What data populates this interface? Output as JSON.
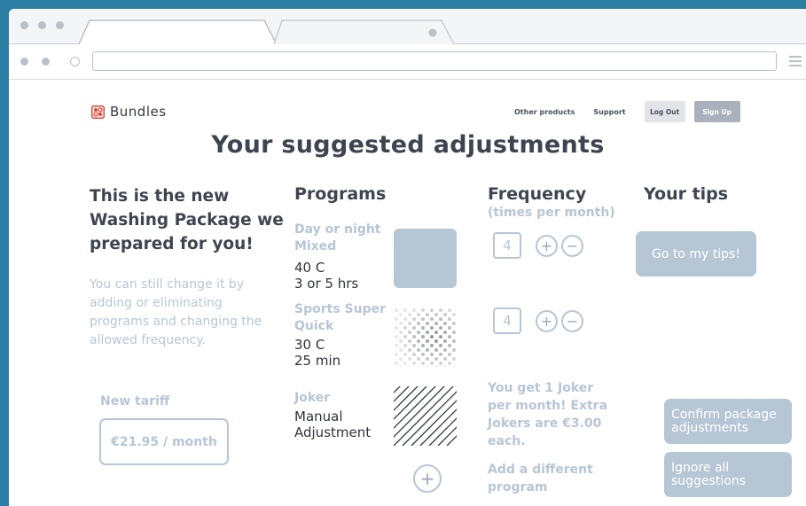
{
  "browser": {
    "address_value": "",
    "icons": [
      "window-dot-icon",
      "tab-icon",
      "reload-icon",
      "menu-icon"
    ]
  },
  "brand": {
    "name": "Bundles",
    "accent": "#e8412e"
  },
  "nav": {
    "other_products": "Other products",
    "support": "Support",
    "log_out": "Log Out",
    "sign_up": "Sign Up"
  },
  "main_title": "Your suggested adjustments",
  "intro": {
    "heading": "This is the new Washing Package we prepared for you!",
    "text": "You can still change it by adding or eliminating programs and changing the allowed frequency."
  },
  "tariff": {
    "label": "New tariff",
    "value": "€21.95 / month"
  },
  "programs": {
    "title": "Programs",
    "items": [
      {
        "name": "Day or night Mixed",
        "detail_line1": "40 C",
        "detail_line2": "3 or 5 hrs",
        "image": "solid"
      },
      {
        "name": "Sports Super Quick",
        "detail_line1": "30 C",
        "detail_line2": "25 min",
        "image": "dots"
      },
      {
        "name": "Joker",
        "detail_line1": "Manual",
        "detail_line2": "Adjustment",
        "image": "stripes"
      }
    ]
  },
  "frequency": {
    "title": "Frequency",
    "subtitle": "(times per month)",
    "values": [
      "4",
      "4"
    ],
    "joker_note": "You get 1 Joker per month! Extra Jokers are €3.00 each.",
    "add_program": "Add a different program"
  },
  "tips": {
    "title": "Your tips",
    "go_button": "Go to my tips!",
    "confirm_button": "Confirm package adjustments",
    "ignore_button": "Ignore all suggestions"
  },
  "colors": {
    "background": "#2b7ea3",
    "muted": "#b7c6d5",
    "heading": "#3f4550"
  }
}
